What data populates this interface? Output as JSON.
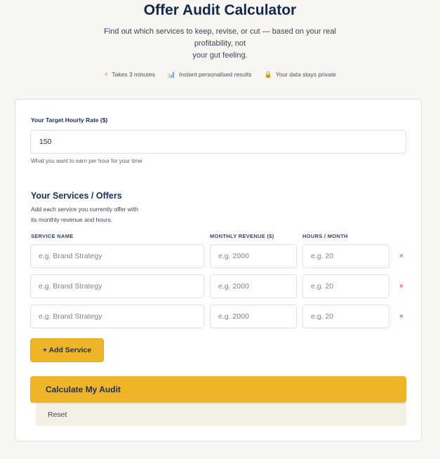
{
  "header": {
    "title": "Offer Audit Calculator",
    "subtitle_line1": "Find out which services to keep, revise, or cut — based on your real",
    "subtitle_line2": "profitability, not",
    "subtitle_line3": "your gut feeling.",
    "badges": [
      {
        "icon": "lightning-icon",
        "glyph": "⚡",
        "text": "Takes 3 minutes"
      },
      {
        "icon": "chart-icon",
        "glyph": "📊",
        "text": "Instant personalised results"
      },
      {
        "icon": "lock-icon",
        "glyph": "🔒",
        "text": "Your data stays private"
      }
    ]
  },
  "rate": {
    "label": "Your Target Hourly Rate ($)",
    "value": "150",
    "hint": "What you want to earn per hour for your time"
  },
  "services": {
    "title": "Your Services / Offers",
    "description_line1": "Add each service you currently offer with",
    "description_line2": "its monthly revenue and hours.",
    "columns": {
      "name": "SERVICE NAME",
      "revenue": "MONTHLY REVENUE ($)",
      "hours": "HOURS / MONTH"
    },
    "rows": [
      {
        "name": "",
        "revenue": "",
        "hours": "",
        "remove_glyph": "×"
      },
      {
        "name": "",
        "revenue": "",
        "hours": "",
        "remove_glyph": "×"
      },
      {
        "name": "",
        "revenue": "",
        "hours": "",
        "remove_glyph": "×"
      }
    ],
    "placeholders": {
      "name": "e.g. Brand Strategy",
      "revenue": "e.g. 2000",
      "hours": "e.g. 20"
    }
  },
  "actions": {
    "add_label": "+ Add Service",
    "calculate_label": "Calculate My Audit",
    "reset_label": "Reset"
  },
  "colors": {
    "accent": "#f0b429",
    "navy": "#1b2f56",
    "remove": "#e04444",
    "background": "#f7f6f2"
  }
}
